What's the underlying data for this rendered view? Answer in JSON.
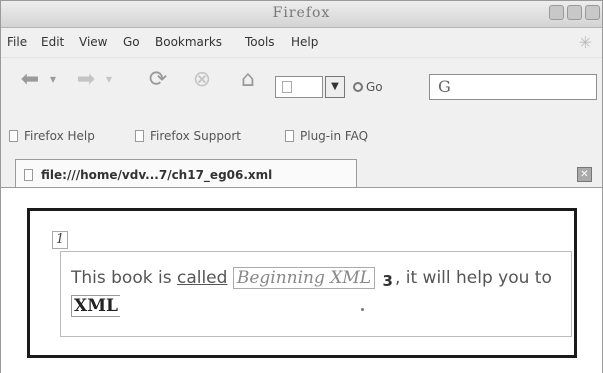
{
  "window": {
    "title": "Firefox"
  },
  "menubar": {
    "items": [
      "File",
      "Edit",
      "View",
      "Go",
      "Bookmarks",
      "Tools",
      "Help"
    ]
  },
  "navbar": {
    "go_label": "Go",
    "search_value": "G"
  },
  "bookmarks": [
    "Firefox Help",
    "Firefox Support",
    "Plug-in FAQ"
  ],
  "tab": {
    "title": "file:///home/vdv...7/ch17_eg06.xml"
  },
  "page": {
    "marker": "1",
    "text_before": "This book is ",
    "called": "called",
    "book_title": "Beginning XML",
    "number": "3",
    "text_after": ", it will help you to ",
    "xml": "XML"
  },
  "icons": {
    "back": "back-arrow-icon",
    "forward": "forward-arrow-icon",
    "reload": "reload-icon",
    "stop": "stop-icon",
    "home": "home-icon"
  }
}
